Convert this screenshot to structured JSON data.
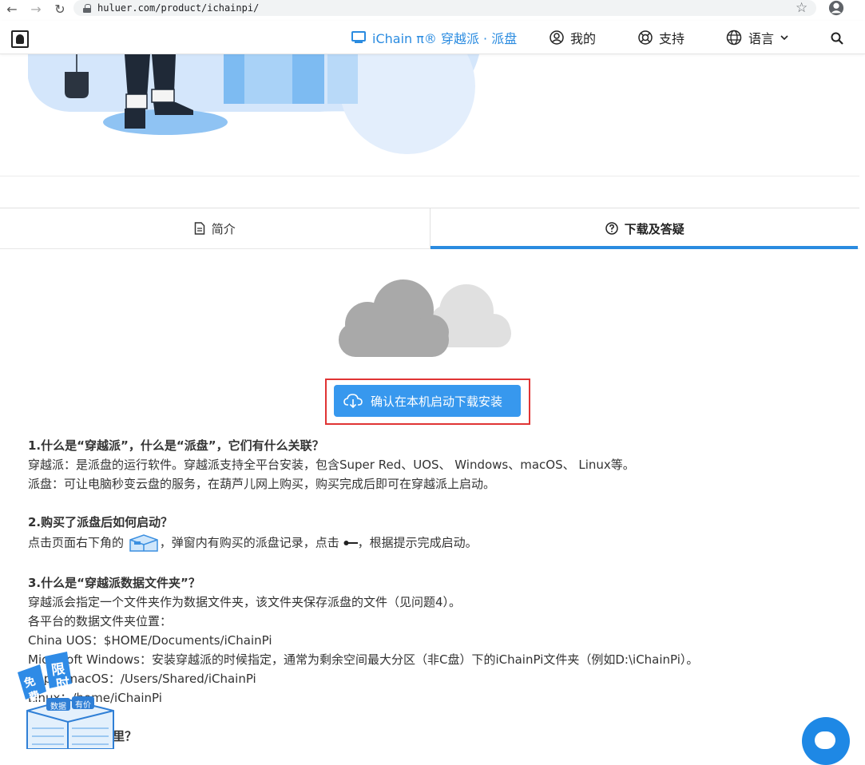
{
  "browser": {
    "url": "huluer.com/product/ichainpi/"
  },
  "header": {
    "brand": "iChain π® 穿越派 · 派盘",
    "nav_mine": "我的",
    "nav_support": "支持",
    "nav_language": "语言"
  },
  "tabs": [
    {
      "label": "简介"
    },
    {
      "label": "下载及答疑"
    }
  ],
  "download_button": "确认在本机启动下载安装",
  "faq": {
    "q1": "1.什么是“穿越派”，什么是“派盘”，它们有什么关联？",
    "q1_a1": "穿越派：是派盘的运行软件。穿越派支持全平台安装，包含Super Red、UOS、 Windows、macOS、 Linux等。",
    "q1_a2": "派盘：可让电脑秒变云盘的服务，在葫芦儿网上购买，购买完成后即可在穿越派上启动。",
    "q2": "2.购买了派盘后如何启动？",
    "q2_a1_pre": "点击页面右下角的",
    "q2_a1_mid": "，弹窗内有购买的派盘记录，点击",
    "q2_a1_post": "，根据提示完成启动。",
    "q3": "3.什么是“穿越派数据文件夹”？",
    "q3_a1": "穿越派会指定一个文件夹作为数据文件夹，该文件夹保存派盘的文件（见问题4）。",
    "q3_a2": "各平台的数据文件夹位置：",
    "q3_a3": "China UOS：$HOME/Documents/iChainPi",
    "q3_a4": "Microsoft Windows：安装穿越派的时候指定，通常为剩余空间最大分区（非C盘）下的iChainPi文件夹（例如D:\\iChainPi）。",
    "q3_a5": "Apple macOS：/Users/Shared/iChainPi",
    "q3_a6": "Linux：/home/iChainPi",
    "q4": "4.派盘文件存哪里？"
  },
  "promo": {
    "badge1": "免",
    "badge2": "费",
    "badge3": "限",
    "badge4": "时",
    "label1": "数据",
    "label2": "有价"
  },
  "colors": {
    "accent": "#2a8be0",
    "button": "#3798ee",
    "highlight_frame": "#e03434"
  }
}
